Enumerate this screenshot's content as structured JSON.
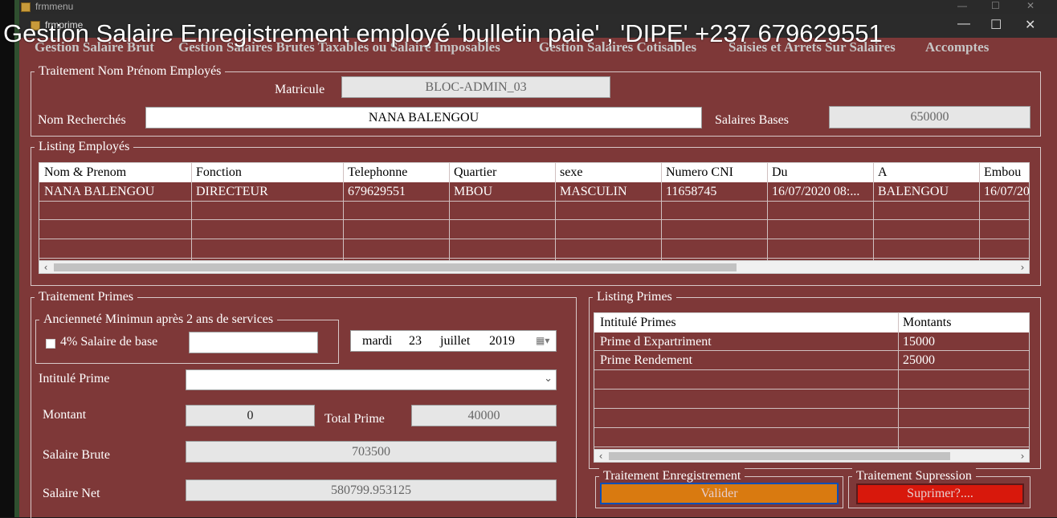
{
  "outer_window": {
    "title": "frmmenu"
  },
  "inner_window": {
    "title": "frmprime"
  },
  "video_overlay_title": "Gestion Salaire Enregistrement employé 'bulletin paie' , 'DIPE' +237 679629551",
  "window_controls": {
    "minimize": "—",
    "maximize": "☐",
    "close": "✕"
  },
  "menu": [
    "Gestion Salaire Brut",
    "Gestion Salaires Brutes Taxables ou Salaire Imposables",
    "Gestion Salaires Cotisables",
    "Saisies et Arrets Sur Salaires",
    "Accomptes"
  ],
  "traitement_employe": {
    "legend": "Traitement  Nom Prénom Employés",
    "matricule_label": "Matricule",
    "matricule_value": "BLOC-ADMIN_03",
    "nom_label": "Nom Recherchés",
    "nom_value": "NANA BALENGOU",
    "salaire_label": "Salaires Bases",
    "salaire_value": "650000"
  },
  "listing_employes": {
    "legend": "Listing Employés",
    "columns": [
      "Nom & Prenom",
      "Fonction",
      "Telephonne",
      "Quartier",
      "sexe",
      "Numero CNI",
      "Du",
      "A",
      "Embou"
    ],
    "rows": [
      [
        "NANA BALENGOU",
        "DIRECTEUR",
        "679629551",
        "MBOU",
        "MASCULIN",
        "11658745",
        "16/07/2020 08:...",
        "BALENGOU",
        "16/07/20"
      ]
    ]
  },
  "traitement_primes": {
    "legend": "Traitement Primes",
    "anciennete_legend": "Ancienneté Minimun après 2 ans de services",
    "checkbox_label": "4% Salaire de base",
    "checkbox_value": "",
    "date": {
      "day_name": "mardi",
      "day": "23",
      "month": "juillet",
      "year": "2019"
    },
    "intitule_label": "Intitulé Prime",
    "intitule_value": "",
    "montant_label": "Montant",
    "montant_value": "0",
    "total_label": "Total Prime",
    "total_value": "40000",
    "brute_label": "Salaire Brute",
    "brute_value": "703500",
    "net_label": "Salaire Net",
    "net_value": "580799.953125"
  },
  "listing_primes": {
    "legend": "Listing Primes",
    "columns": [
      "Intitulé Primes",
      "Montants"
    ],
    "rows": [
      [
        "Prime d Expartriment",
        "15000"
      ],
      [
        "Prime Rendement",
        "25000"
      ]
    ]
  },
  "enregistrement": {
    "legend": "Traitement Enregistrement",
    "button": "Valider"
  },
  "suppression": {
    "legend": "Traitement Supression",
    "button": "Suprimer?...."
  },
  "colors": {
    "window_bg": "#7e3838",
    "valider_bg": "#d97a10",
    "suprimer_bg": "#d8180c"
  }
}
